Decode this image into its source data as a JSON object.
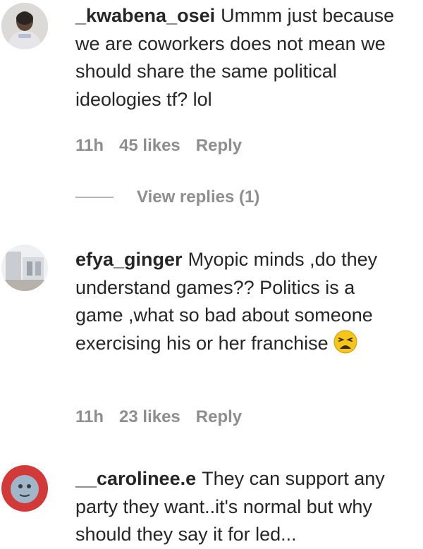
{
  "comments": [
    {
      "username": "_kwabena_osei",
      "text": "Ummm just because we are coworkers does not mean we should share the same political ideologies tf? lol",
      "time": "11h",
      "likes": "45 likes",
      "reply_label": "Reply",
      "view_replies_label": "View replies (1)"
    },
    {
      "username": "efya_ginger",
      "text": "Myopic minds ,do they understand games?? Politics is a game ,what so bad about someone exercising his or her franchise",
      "emoji": "tired-face-emoji",
      "time": "11h",
      "likes": "23 likes",
      "reply_label": "Reply"
    },
    {
      "username": "__carolinee.e",
      "text": "They can support any party they want..it's normal but why should they say it for led..."
    }
  ],
  "colors": {
    "text": "#262626",
    "meta": "#8e8e8e"
  }
}
